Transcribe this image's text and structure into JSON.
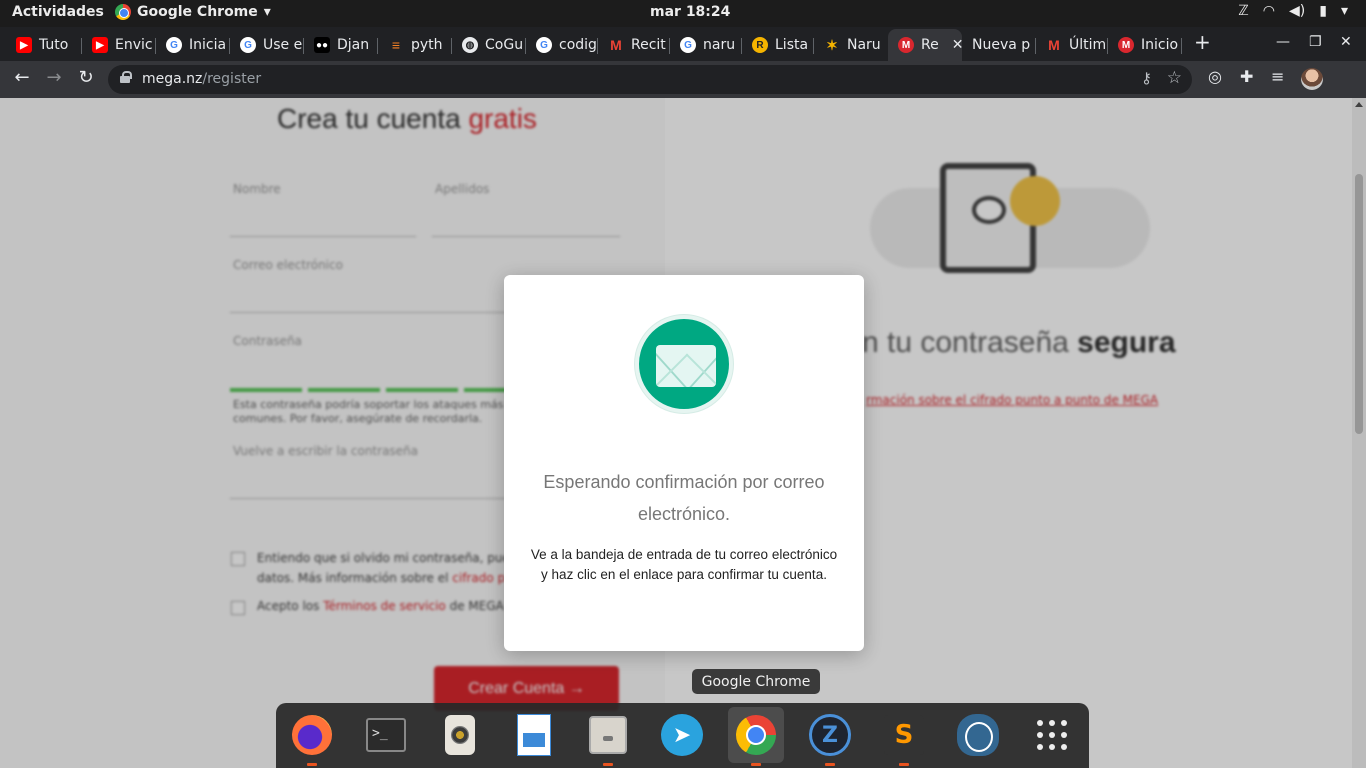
{
  "topbar": {
    "activities": "Actividades",
    "app_name": "Google Chrome",
    "clock": "mar 18:24",
    "tray": [
      "zeal-tray-icon",
      "wifi-icon",
      "volume-icon",
      "battery-icon",
      "chevron-down-icon"
    ]
  },
  "tabs": [
    {
      "label": "Tuto",
      "favicon": "youtube-icon",
      "color": "#ff0000"
    },
    {
      "label": "Envic",
      "favicon": "youtube-icon",
      "color": "#ff0000"
    },
    {
      "label": "Inicia",
      "favicon": "google-icon",
      "color": "#4285f4"
    },
    {
      "label": "Use e",
      "favicon": "google-icon",
      "color": "#4285f4"
    },
    {
      "label": "Djan",
      "favicon": "medium-icon",
      "color": "#000000"
    },
    {
      "label": "pyth",
      "favicon": "stackoverflow-icon",
      "color": "#f48024"
    },
    {
      "label": "CoGu",
      "favicon": "globe-icon",
      "color": "#9aa0a6"
    },
    {
      "label": "codig",
      "favicon": "google-icon",
      "color": "#4285f4"
    },
    {
      "label": "Recit",
      "favicon": "gmail-icon",
      "color": "#ea4335"
    },
    {
      "label": "naru",
      "favicon": "google-icon",
      "color": "#4285f4"
    },
    {
      "label": "Lista",
      "favicon": "r-icon",
      "color": "#f5b400"
    },
    {
      "label": "Naru",
      "favicon": "naruto-icon",
      "color": "#f5b400"
    },
    {
      "label": "Re",
      "favicon": "mega-icon",
      "color": "#d9272e",
      "active": true
    },
    {
      "label": "Nueva p",
      "favicon": "",
      "color": ""
    },
    {
      "label": "Últim",
      "favicon": "gmail-icon",
      "color": "#ea4335"
    },
    {
      "label": "Inicio",
      "favicon": "mega-icon",
      "color": "#d9272e"
    }
  ],
  "toolbar": {
    "url_host": "mega.nz",
    "url_path": "/register"
  },
  "page": {
    "title_main": "Crea tu cuenta",
    "title_accent": "gratis",
    "first_name_label": "Nombre",
    "last_name_label": "Apellidos",
    "email_label": "Correo electrónico",
    "password_label": "Contraseña",
    "strength_text": "Esta contraseña podría soportar los ataques más comunes. Por favor, asegúrate de recordarla.",
    "repeat_password_label": "Vuelve a escribir la contraseña",
    "check1_text": "Entiendo que si olvido mi contraseña, puedo perder mis datos. Más información sobre el",
    "check1_link": "cifrado punto a punto",
    "check2_text": "Acepto los",
    "check2_link": "Términos de servicio",
    "check2_suffix": "de MEGA",
    "create_button": "Crear Cuenta",
    "right_heading_prefix": "n tu contraseña",
    "right_heading_bold": "segura",
    "right_link": "rmación sobre el cifrado punto a punto de MEGA"
  },
  "modal": {
    "icon": "envelope-icon",
    "title": "Esperando confirmación por correo electrónico.",
    "body": "Ve a la bandeja de entrada de tu correo electrónico y haz clic en el enlace para confirmar tu cuenta."
  },
  "tooltip": "Google Chrome",
  "dock": [
    {
      "name": "firefox",
      "running": true
    },
    {
      "name": "terminal",
      "running": false
    },
    {
      "name": "rhythmbox",
      "running": false
    },
    {
      "name": "libreoffice-writer",
      "running": false
    },
    {
      "name": "files",
      "running": true
    },
    {
      "name": "telegram",
      "running": false
    },
    {
      "name": "google-chrome",
      "running": true,
      "focused": true
    },
    {
      "name": "zeal",
      "running": true
    },
    {
      "name": "sublime-text",
      "running": true
    },
    {
      "name": "pgadmin",
      "running": false
    },
    {
      "name": "show-applications",
      "running": false
    }
  ],
  "colors": {
    "mega_red": "#d9272e",
    "mail_green": "#00a882",
    "ubuntu_orange": "#e95420"
  }
}
